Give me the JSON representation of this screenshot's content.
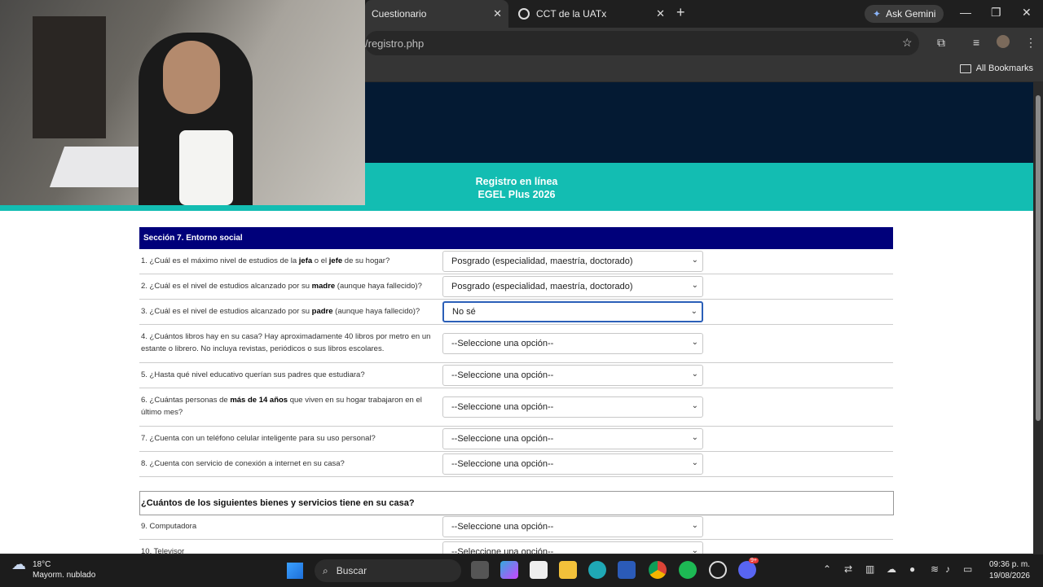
{
  "browser": {
    "tabs": [
      {
        "title": "Cuestionario",
        "active": true
      },
      {
        "title": "CCT de la UATx",
        "active": false
      }
    ],
    "gemini_label": "Ask Gemini",
    "url": "/registro.php",
    "bookmarks_label": "All Bookmarks"
  },
  "page": {
    "header_title": "Registro en línea",
    "header_subtitle": "EGEL Plus 2026",
    "section_title": "Sección 7. Entorno social",
    "questions": [
      {
        "pre": "1. ¿Cuál es el máximo nivel de estudios de la ",
        "b1": "jefa",
        "mid": " o el ",
        "b2": "jefe",
        "post": " de su hogar?",
        "answer": "Posgrado (especialidad, maestría, doctorado)"
      },
      {
        "pre": "2. ¿Cuál es el nivel de estudios alcanzado por su ",
        "b1": "madre",
        "post": " (aunque haya fallecido)?",
        "answer": "Posgrado (especialidad, maestría, doctorado)"
      },
      {
        "pre": "3. ¿Cuál es el nivel de estudios alcanzado por su ",
        "b1": "padre",
        "post": " (aunque haya fallecido)?",
        "answer": "No sé"
      },
      {
        "pre": "4. ¿Cuántos libros hay en su casa? Hay aproximadamente 40 libros por metro en un estante o librero. No incluya revistas, periódicos o sus libros escolares.",
        "answer": "--Seleccione una opción--"
      },
      {
        "pre": "5. ¿Hasta qué nivel educativo querían sus padres que estudiara?",
        "answer": "--Seleccione una opción--"
      },
      {
        "pre": "6. ¿Cuántas personas de ",
        "b1": "más de 14 años",
        "post": " que viven en su hogar trabajaron en el último mes?",
        "answer": "--Seleccione una opción--"
      },
      {
        "pre": "7. ¿Cuenta con un teléfono celular inteligente para su uso personal?",
        "answer": "--Seleccione una opción--"
      },
      {
        "pre": "8. ¿Cuenta con servicio de conexión a internet en su casa?",
        "answer": "--Seleccione una opción--"
      }
    ],
    "subsection_title": "¿Cuántos de los siguientes bienes y servicios tiene en su casa?",
    "items": [
      {
        "label": "9. Computadora",
        "answer": "--Seleccione una opción--"
      },
      {
        "label": "10. Televisor",
        "answer": "--Seleccione una opción--"
      }
    ]
  },
  "taskbar": {
    "temperature": "18°C",
    "weather": "Mayorm. nublado",
    "search_placeholder": "Buscar",
    "time": "09:36 p. m.",
    "date": "19/08/2026",
    "discord_badge": "9+"
  },
  "colors": {
    "header_dark": "#041a33",
    "teal": "#13bdb2",
    "section_blue": "#00007a"
  }
}
